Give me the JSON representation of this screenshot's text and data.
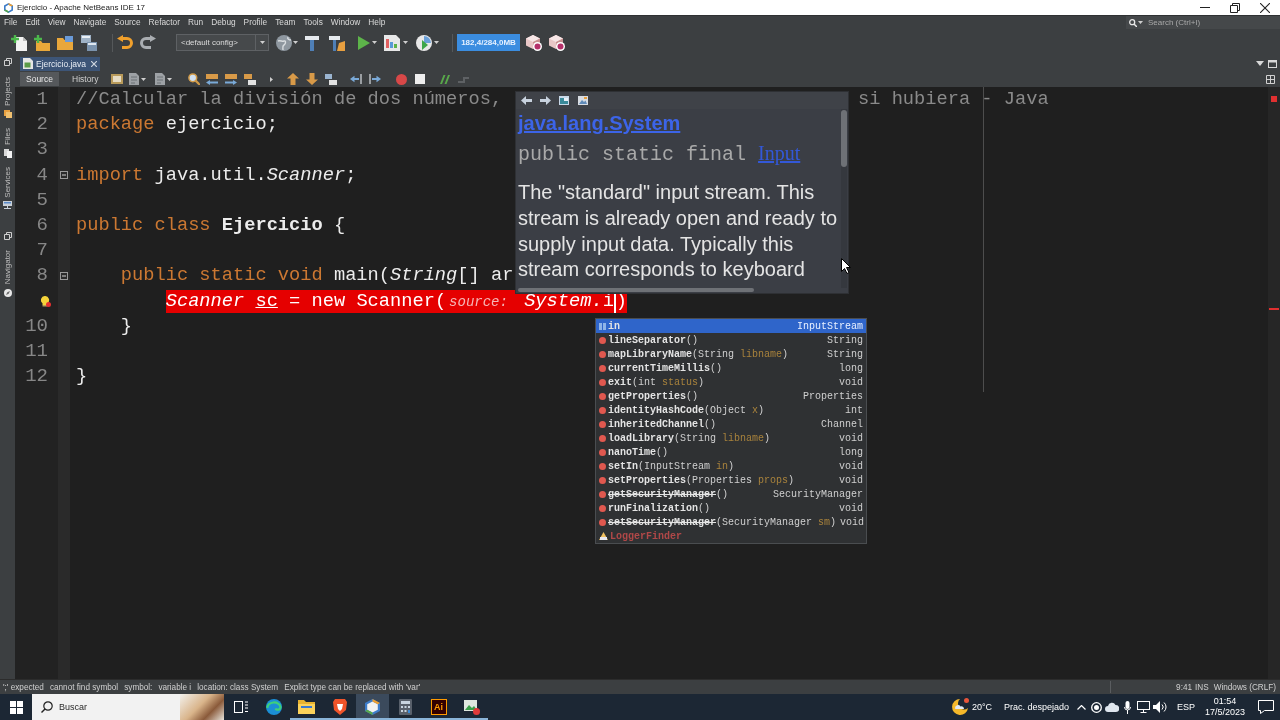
{
  "window": {
    "title": "Ejercicio - Apache NetBeans IDE 17"
  },
  "menu": [
    "File",
    "Edit",
    "View",
    "Navigate",
    "Source",
    "Refactor",
    "Run",
    "Debug",
    "Profile",
    "Team",
    "Tools",
    "Window",
    "Help"
  ],
  "search": {
    "placeholder": "Search (Ctrl+I)"
  },
  "toolbar": {
    "configuration": "<default config>",
    "memory": "182,4/284,0MB"
  },
  "side_panels": [
    "Projects",
    "Files",
    "Services",
    "Navigator"
  ],
  "tabs": [
    {
      "label": "Ejercicio.java",
      "selected": true
    }
  ],
  "editor_views": [
    {
      "label": "Source",
      "selected": true
    },
    {
      "label": "History",
      "selected": false
    }
  ],
  "editor": {
    "lines": [
      {
        "number": "1",
        "error": false,
        "fold": false,
        "tokens": [
          {
            "kind": "comment",
            "text": "//Calcular la división de dos números,"
          }
        ],
        "tokens_right_of_popup": [
          {
            "kind": "comment",
            "text": "si hubiera - Java"
          }
        ]
      },
      {
        "number": "2",
        "error": false,
        "fold": false,
        "tokens": [
          {
            "kind": "keyword",
            "text": "package"
          },
          {
            "kind": "plain",
            "text": " ejercicio;"
          }
        ]
      },
      {
        "number": "3",
        "error": false,
        "fold": false
      },
      {
        "number": "4",
        "error": false,
        "fold": true,
        "tokens": [
          {
            "kind": "keyword",
            "text": "import"
          },
          {
            "kind": "plain",
            "text": " java.util."
          },
          {
            "kind": "type",
            "text": "Scanner"
          },
          {
            "kind": "plain",
            "text": ";"
          }
        ]
      },
      {
        "number": "5",
        "error": false,
        "fold": false
      },
      {
        "number": "6",
        "error": false,
        "fold": false,
        "tokens": [
          {
            "kind": "keyword",
            "text": "public class"
          },
          {
            "kind": "class",
            "text": " Ejercicio"
          },
          {
            "kind": "plain",
            "text": " {"
          }
        ]
      },
      {
        "number": "7",
        "error": false,
        "fold": false
      },
      {
        "number": "8",
        "error": false,
        "fold": true,
        "tokens": [
          {
            "kind": "keyword",
            "text": "    public static void"
          },
          {
            "kind": "plain",
            "text": " main("
          },
          {
            "kind": "type",
            "text": "String"
          },
          {
            "kind": "plain",
            "text": "[] ar"
          }
        ]
      },
      {
        "error": true,
        "fold": false,
        "tokens": [
          {
            "kind": "type",
            "text": "        Scanner "
          },
          {
            "kind": "underlined",
            "text": "sc"
          },
          {
            "kind": "plain",
            "text": " = "
          },
          {
            "kind": "keyword",
            "text": "new"
          },
          {
            "kind": "plain",
            "text": " Scanner("
          },
          {
            "kind": "hint",
            "text": "source:"
          },
          {
            "kind": "type",
            "text": " System."
          },
          {
            "kind": "plain",
            "text": "i"
          },
          {
            "kind": "caret"
          },
          {
            "kind": "plain",
            "text": ")"
          }
        ]
      },
      {
        "number": "10",
        "error": false,
        "fold": false,
        "tokens": [
          {
            "kind": "plain",
            "text": "    }"
          }
        ]
      },
      {
        "number": "11",
        "error": false,
        "fold": false
      },
      {
        "number": "12",
        "error": false,
        "fold": false,
        "tokens": [
          {
            "kind": "plain",
            "text": "}"
          }
        ]
      }
    ],
    "javadoc": {
      "title": "java.lang.System",
      "signature": "public static final ",
      "signature_link": "Input",
      "description": "The \"standard\" input stream. This stream is already open and ready to supply input data. Typically this stream corresponds to keyboard"
    },
    "completion": [
      {
        "kind": "field",
        "label": [
          {
            "kind": "name",
            "text": "in"
          }
        ],
        "type": "InputStream",
        "deprecated": false,
        "selected": true
      },
      {
        "kind": "method",
        "label": [
          {
            "kind": "name",
            "text": "lineSeparator"
          },
          {
            "kind": "plain",
            "text": "()"
          }
        ],
        "type": "String",
        "deprecated": false,
        "selected": false
      },
      {
        "kind": "method",
        "label": [
          {
            "kind": "name",
            "text": "mapLibraryName"
          },
          {
            "kind": "plain",
            "text": "(String "
          },
          {
            "kind": "param",
            "text": "libname"
          },
          {
            "kind": "plain",
            "text": ")"
          }
        ],
        "type": "String",
        "deprecated": false,
        "selected": false
      },
      {
        "kind": "method",
        "label": [
          {
            "kind": "name",
            "text": "currentTimeMillis"
          },
          {
            "kind": "plain",
            "text": "()"
          }
        ],
        "type": "long",
        "deprecated": false,
        "selected": false
      },
      {
        "kind": "method",
        "label": [
          {
            "kind": "name",
            "text": "exit"
          },
          {
            "kind": "plain",
            "text": "(int "
          },
          {
            "kind": "param",
            "text": "status"
          },
          {
            "kind": "plain",
            "text": ")"
          }
        ],
        "type": "void",
        "deprecated": false,
        "selected": false
      },
      {
        "kind": "method",
        "label": [
          {
            "kind": "name",
            "text": "getProperties"
          },
          {
            "kind": "plain",
            "text": "()"
          }
        ],
        "type": "Properties",
        "deprecated": false,
        "selected": false
      },
      {
        "kind": "method",
        "label": [
          {
            "kind": "name",
            "text": "identityHashCode"
          },
          {
            "kind": "plain",
            "text": "(Object "
          },
          {
            "kind": "param",
            "text": "x"
          },
          {
            "kind": "plain",
            "text": ")"
          }
        ],
        "type": "int",
        "deprecated": false,
        "selected": false
      },
      {
        "kind": "method",
        "label": [
          {
            "kind": "name",
            "text": "inheritedChannel"
          },
          {
            "kind": "plain",
            "text": "()"
          }
        ],
        "type": "Channel",
        "deprecated": false,
        "selected": false
      },
      {
        "kind": "method",
        "label": [
          {
            "kind": "name",
            "text": "loadLibrary"
          },
          {
            "kind": "plain",
            "text": "(String "
          },
          {
            "kind": "param",
            "text": "libname"
          },
          {
            "kind": "plain",
            "text": ")"
          }
        ],
        "type": "void",
        "deprecated": false,
        "selected": false
      },
      {
        "kind": "method",
        "label": [
          {
            "kind": "name",
            "text": "nanoTime"
          },
          {
            "kind": "plain",
            "text": "()"
          }
        ],
        "type": "long",
        "deprecated": false,
        "selected": false
      },
      {
        "kind": "method",
        "label": [
          {
            "kind": "name",
            "text": "setIn"
          },
          {
            "kind": "plain",
            "text": "(InputStream "
          },
          {
            "kind": "param",
            "text": "in"
          },
          {
            "kind": "plain",
            "text": ")"
          }
        ],
        "type": "void",
        "deprecated": false,
        "selected": false
      },
      {
        "kind": "method",
        "label": [
          {
            "kind": "name",
            "text": "setProperties"
          },
          {
            "kind": "plain",
            "text": "(Properties "
          },
          {
            "kind": "param",
            "text": "props"
          },
          {
            "kind": "plain",
            "text": ")"
          }
        ],
        "type": "void",
        "deprecated": false,
        "selected": false
      },
      {
        "kind": "method",
        "label": [
          {
            "kind": "name",
            "text": "getSecurityManager"
          },
          {
            "kind": "plain",
            "text": "()"
          }
        ],
        "type": "SecurityManager",
        "deprecated": true,
        "selected": false
      },
      {
        "kind": "method",
        "label": [
          {
            "kind": "name",
            "text": "runFinalization"
          },
          {
            "kind": "plain",
            "text": "()"
          }
        ],
        "type": "void",
        "deprecated": false,
        "selected": false
      },
      {
        "kind": "method",
        "label": [
          {
            "kind": "name",
            "text": "setSecurityManager"
          },
          {
            "kind": "plain",
            "text": "(SecurityManager "
          },
          {
            "kind": "param",
            "text": "sm"
          },
          {
            "kind": "plain",
            "text": ")"
          }
        ],
        "type": "void",
        "deprecated": true,
        "selected": false
      },
      {
        "kind": "class",
        "label": [
          {
            "kind": "name",
            "text": "LoggerFinder"
          }
        ],
        "deprecated": false,
        "selected": false
      }
    ]
  },
  "status_bar": {
    "messages": [
      "';' expected",
      "cannot find symbol",
      "symbol:",
      "variable i",
      "location: class System",
      "Explict type can be replaced with 'var'"
    ],
    "caret_position": "9:41",
    "insert_mode": "INS",
    "line_endings": "Windows (CRLF)"
  },
  "taskbar": {
    "search_placeholder": "Buscar",
    "apps": [
      {
        "kind": "task-view",
        "open": false,
        "selected": false
      },
      {
        "kind": "browser",
        "open": false,
        "selected": false
      },
      {
        "kind": "folder",
        "open": true,
        "selected": false
      },
      {
        "kind": "shield",
        "open": true,
        "selected": false
      },
      {
        "kind": "cube",
        "open": true,
        "selected": true
      },
      {
        "kind": "calculator",
        "open": true,
        "selected": false
      },
      {
        "kind": "logo",
        "label": "Ai",
        "open": true,
        "selected": false
      },
      {
        "kind": "photo",
        "open": true,
        "selected": false
      }
    ],
    "weather": {
      "temperature": "20°C",
      "condition": "Prac. despejado"
    },
    "language": "ESP",
    "time": "01:54",
    "date": "17/5/2023"
  }
}
